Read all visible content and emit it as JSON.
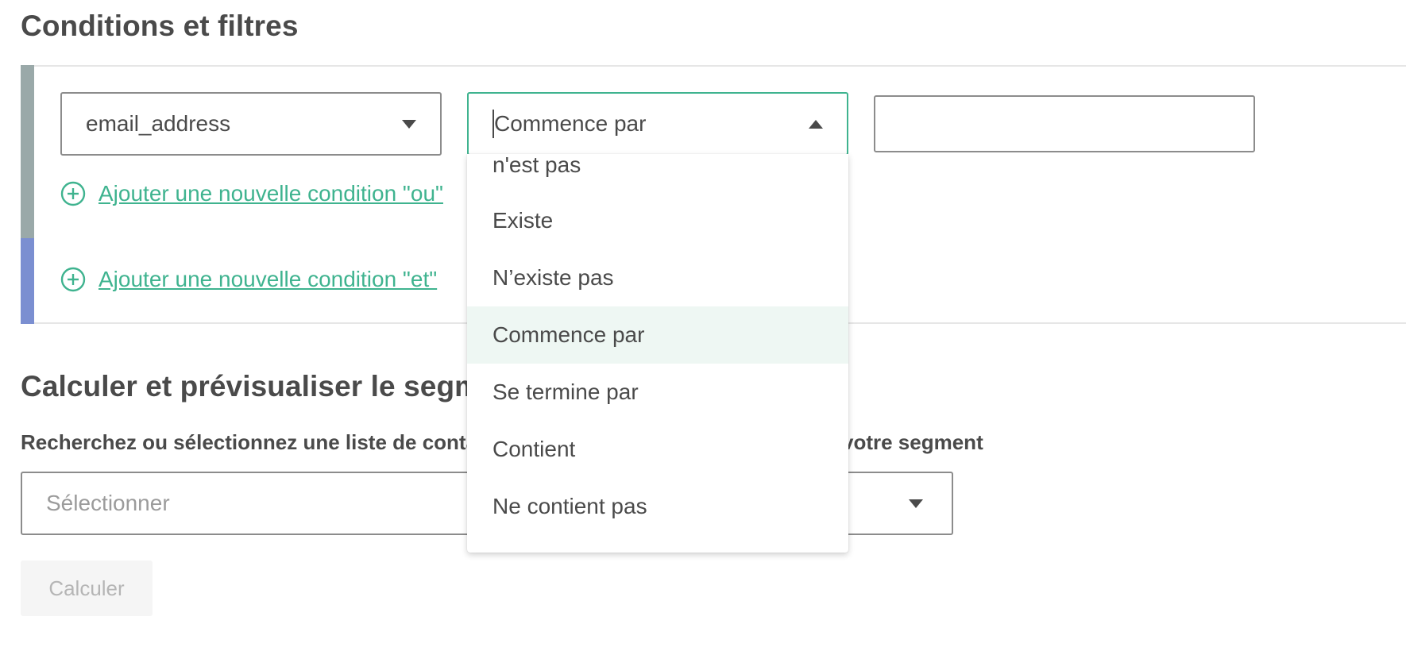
{
  "section_conditions": {
    "title": "Conditions et filtres"
  },
  "condition_group_or": {
    "field_select": {
      "value": "email_address"
    },
    "operator_select": {
      "value": "Commence par",
      "open": true
    },
    "value_input": {
      "value": ""
    },
    "add_or_label": "Ajouter une nouvelle condition \"ou\""
  },
  "condition_group_and": {
    "add_and_label": "Ajouter une nouvelle condition \"et\""
  },
  "operator_dropdown": {
    "options": [
      {
        "label": "n'est pas"
      },
      {
        "label": "Existe"
      },
      {
        "label": "N’existe pas"
      },
      {
        "label": "Commence par",
        "highlighted": true
      },
      {
        "label": "Se termine par"
      },
      {
        "label": "Contient"
      },
      {
        "label": "Ne contient pas"
      }
    ]
  },
  "section_preview": {
    "title": "Calculer et prévisualiser le segment",
    "subtitle_start": "Recherchez ou sélectionnez une liste de contacts",
    "subtitle_end": "votre segment",
    "list_select": {
      "placeholder": "Sélectionner"
    },
    "calculate_label": "Calculer"
  },
  "colors": {
    "accent": "#3fb38f",
    "or_group_bar": "#9aa9a9",
    "and_group_bar": "#7b8fd1",
    "highlight_bg": "#eef7f3",
    "text": "#4a4a4a"
  },
  "icons": {
    "add": "plus-circle-icon",
    "dropdown": "caret-down-icon",
    "dropdown_open": "caret-up-icon"
  }
}
